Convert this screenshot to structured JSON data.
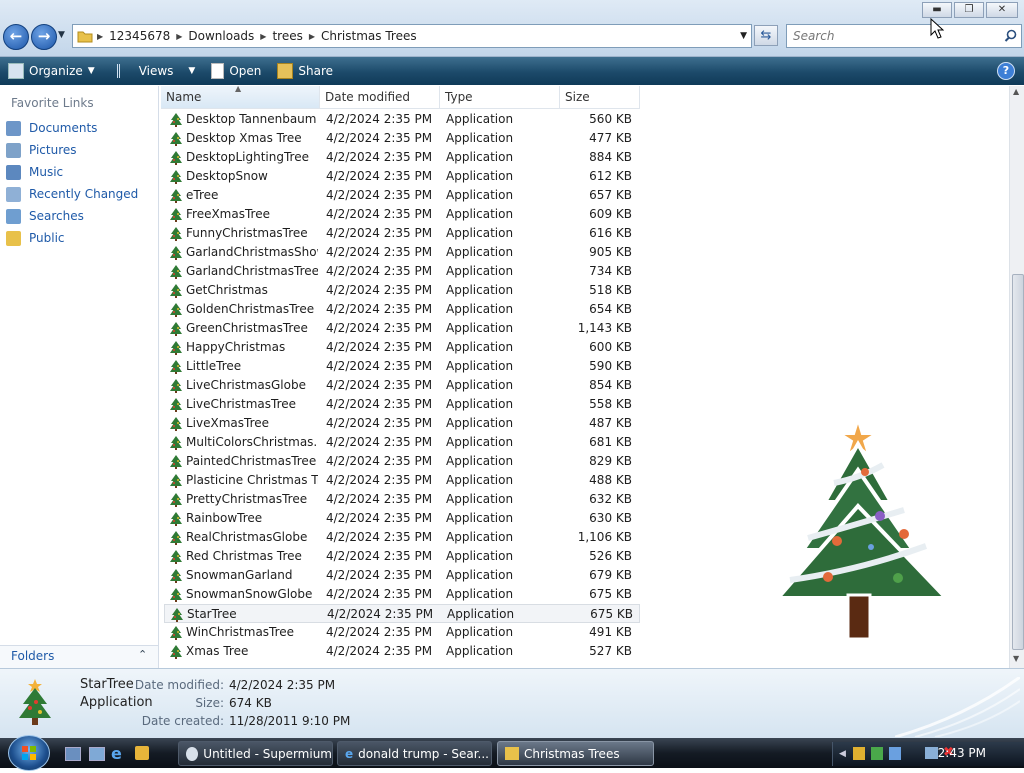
{
  "address": {
    "crumbs": [
      "12345678",
      "Downloads",
      "trees",
      "Christmas Trees"
    ]
  },
  "search": {
    "placeholder": "Search"
  },
  "toolbar": {
    "organize": "Organize",
    "views": "Views",
    "open": "Open",
    "share": "Share",
    "help": "?"
  },
  "sidebar": {
    "title": "Favorite Links",
    "items": [
      {
        "label": "Documents"
      },
      {
        "label": "Pictures"
      },
      {
        "label": "Music"
      },
      {
        "label": "Recently Changed"
      },
      {
        "label": "Searches"
      },
      {
        "label": "Public"
      }
    ],
    "folders_label": "Folders"
  },
  "columns": {
    "name": "Name",
    "date": "Date modified",
    "type": "Type",
    "size": "Size"
  },
  "files": [
    {
      "name": "Desktop Tannenbaum",
      "date": "4/2/2024 2:35 PM",
      "type": "Application",
      "size": "560 KB"
    },
    {
      "name": "Desktop Xmas Tree",
      "date": "4/2/2024 2:35 PM",
      "type": "Application",
      "size": "477 KB"
    },
    {
      "name": "DesktopLightingTree",
      "date": "4/2/2024 2:35 PM",
      "type": "Application",
      "size": "884 KB"
    },
    {
      "name": "DesktopSnow",
      "date": "4/2/2024 2:35 PM",
      "type": "Application",
      "size": "612 KB"
    },
    {
      "name": "eTree",
      "date": "4/2/2024 2:35 PM",
      "type": "Application",
      "size": "657 KB"
    },
    {
      "name": "FreeXmasTree",
      "date": "4/2/2024 2:35 PM",
      "type": "Application",
      "size": "609 KB"
    },
    {
      "name": "FunnyChristmasTree",
      "date": "4/2/2024 2:35 PM",
      "type": "Application",
      "size": "616 KB"
    },
    {
      "name": "GarlandChristmasShow",
      "date": "4/2/2024 2:35 PM",
      "type": "Application",
      "size": "905 KB"
    },
    {
      "name": "GarlandChristmasTree",
      "date": "4/2/2024 2:35 PM",
      "type": "Application",
      "size": "734 KB"
    },
    {
      "name": "GetChristmas",
      "date": "4/2/2024 2:35 PM",
      "type": "Application",
      "size": "518 KB"
    },
    {
      "name": "GoldenChristmasTree",
      "date": "4/2/2024 2:35 PM",
      "type": "Application",
      "size": "654 KB"
    },
    {
      "name": "GreenChristmasTree",
      "date": "4/2/2024 2:35 PM",
      "type": "Application",
      "size": "1,143 KB"
    },
    {
      "name": "HappyChristmas",
      "date": "4/2/2024 2:35 PM",
      "type": "Application",
      "size": "600 KB"
    },
    {
      "name": "LittleTree",
      "date": "4/2/2024 2:35 PM",
      "type": "Application",
      "size": "590 KB"
    },
    {
      "name": "LiveChristmasGlobe",
      "date": "4/2/2024 2:35 PM",
      "type": "Application",
      "size": "854 KB"
    },
    {
      "name": "LiveChristmasTree",
      "date": "4/2/2024 2:35 PM",
      "type": "Application",
      "size": "558 KB"
    },
    {
      "name": "LiveXmasTree",
      "date": "4/2/2024 2:35 PM",
      "type": "Application",
      "size": "487 KB"
    },
    {
      "name": "MultiColorsChristmas...",
      "date": "4/2/2024 2:35 PM",
      "type": "Application",
      "size": "681 KB"
    },
    {
      "name": "PaintedChristmasTree",
      "date": "4/2/2024 2:35 PM",
      "type": "Application",
      "size": "829 KB"
    },
    {
      "name": "Plasticine Christmas Tr...",
      "date": "4/2/2024 2:35 PM",
      "type": "Application",
      "size": "488 KB"
    },
    {
      "name": "PrettyChristmasTree",
      "date": "4/2/2024 2:35 PM",
      "type": "Application",
      "size": "632 KB"
    },
    {
      "name": "RainbowTree",
      "date": "4/2/2024 2:35 PM",
      "type": "Application",
      "size": "630 KB"
    },
    {
      "name": "RealChristmasGlobe",
      "date": "4/2/2024 2:35 PM",
      "type": "Application",
      "size": "1,106 KB"
    },
    {
      "name": "Red Christmas Tree",
      "date": "4/2/2024 2:35 PM",
      "type": "Application",
      "size": "526 KB"
    },
    {
      "name": "SnowmanGarland",
      "date": "4/2/2024 2:35 PM",
      "type": "Application",
      "size": "679 KB"
    },
    {
      "name": "SnowmanSnowGlobe",
      "date": "4/2/2024 2:35 PM",
      "type": "Application",
      "size": "675 KB"
    },
    {
      "name": "StarTree",
      "date": "4/2/2024 2:35 PM",
      "type": "Application",
      "size": "675 KB"
    },
    {
      "name": "WinChristmasTree",
      "date": "4/2/2024 2:35 PM",
      "type": "Application",
      "size": "491 KB"
    },
    {
      "name": "Xmas Tree",
      "date": "4/2/2024 2:35 PM",
      "type": "Application",
      "size": "527 KB"
    }
  ],
  "selected_index": 26,
  "details": {
    "name": "StarTree",
    "type": "Application",
    "modified_label": "Date modified:",
    "modified": "4/2/2024 2:35 PM",
    "size_label": "Size:",
    "size": "674 KB",
    "created_label": "Date created:",
    "created": "11/28/2011 9:10 PM"
  },
  "taskbar": {
    "tasks": [
      {
        "label": "Untitled - Supermium"
      },
      {
        "label": "donald trump - Sear..."
      },
      {
        "label": "Christmas Trees"
      }
    ],
    "clock": "2:43 PM"
  },
  "colors": {
    "link": "#1f5aa8",
    "toolbar": "#1c4a6a",
    "taskbar": "#141b24"
  }
}
